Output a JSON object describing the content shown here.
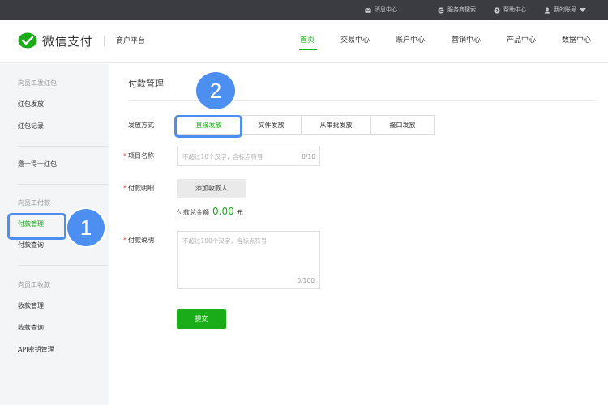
{
  "topbar": {
    "items": [
      {
        "label": "消息中心",
        "icon": "mail-icon"
      },
      {
        "label": "服务商搜索",
        "icon": "g-icon"
      },
      {
        "label": "帮助中心",
        "icon": "help-icon"
      },
      {
        "label": "我的账号",
        "icon": "user-icon"
      }
    ]
  },
  "header": {
    "brand": "微信支付",
    "platform": "商户平台",
    "nav": [
      "首页",
      "交易中心",
      "账户中心",
      "营销中心",
      "产品中心",
      "数据中心"
    ],
    "active_nav": "首页"
  },
  "sidebar": {
    "group1": "向员工发红包",
    "item_hongbao_send": "红包发放",
    "item_hongbao_record": "红包记录",
    "item_yiyu": "邀一得一红包",
    "group2": "向员工付款",
    "item_pay_manage": "付款管理",
    "item_pay_query": "付款查询",
    "group3": "向员工收款",
    "item_collect_manage": "收款管理",
    "item_collect_query": "收款查询",
    "item_api_key": "API密钥管理"
  },
  "main": {
    "title": "付款管理",
    "method_label": "发放方式",
    "tabs": [
      "直接发放",
      "文件发放",
      "从审批发放",
      "接口发放"
    ],
    "active_tab": "直接发放",
    "project_label": "项目名称",
    "project_placeholder": "不超过10个汉字，含标点符号",
    "project_counter": "0/10",
    "detail_label": "付款明细",
    "add_payee_label": "添加收款人",
    "total_label": "付款总金额",
    "total_amount": "0.00",
    "total_unit": "元",
    "desc_label": "付款说明",
    "desc_placeholder": "不超过100个汉字，含标点符号",
    "desc_counter": "0/100",
    "submit_label": "提交"
  },
  "annotations": {
    "badge1": "1",
    "badge2": "2"
  },
  "colors": {
    "brand_green": "#1aad19",
    "callout_blue": "#4d8ff0",
    "topbar_bg": "#3a3c41",
    "required_red": "#e64340"
  }
}
